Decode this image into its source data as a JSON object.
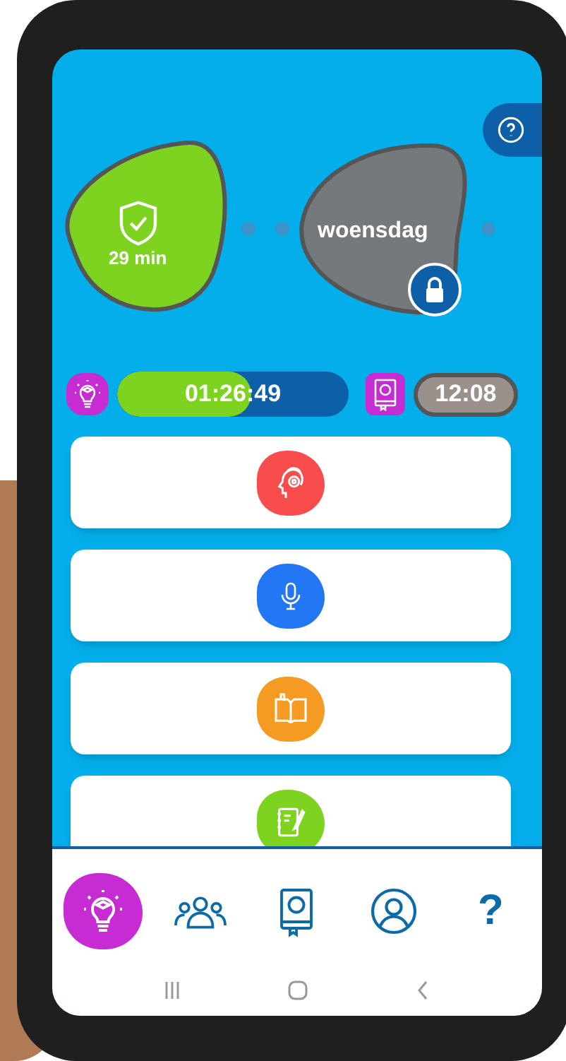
{
  "days": [
    {
      "kind": "done",
      "label": "29 min"
    },
    {
      "kind": "locked",
      "label": "woensdag"
    }
  ],
  "timer": {
    "level": 0.58,
    "reading": "01:26:49"
  },
  "clock": {
    "reading": "12:08"
  },
  "cards": [
    {
      "kind": "listening",
      "color": "#f94c4c"
    },
    {
      "kind": "speaking",
      "color": "#2377f5"
    },
    {
      "kind": "reading",
      "color": "#f59a23"
    },
    {
      "kind": "writing",
      "color": "#7ed321"
    }
  ],
  "nav": [
    {
      "kind": "lessons",
      "selected": true
    },
    {
      "kind": "groups",
      "selected": false
    },
    {
      "kind": "dictionary",
      "selected": false
    },
    {
      "kind": "profile",
      "selected": false
    },
    {
      "kind": "help",
      "selected": false,
      "label": "?"
    }
  ]
}
